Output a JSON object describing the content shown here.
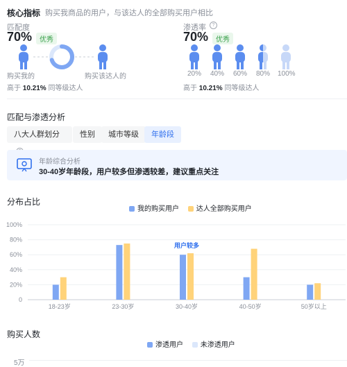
{
  "header": {
    "title": "核心指标",
    "subtitle": "购买我商品的用户，与该达人的全部购买用户相比"
  },
  "match": {
    "label": "匹配度",
    "value": "70%",
    "badge": "优秀",
    "left_caption": "购买我的",
    "right_caption": "购买该达人的",
    "compare_prefix": "高于",
    "compare_value": "10.21%",
    "compare_suffix": "同等级达人",
    "ring_fraction": 0.7
  },
  "penetration": {
    "label": "渗透率",
    "value": "70%",
    "badge": "优秀",
    "levels": [
      "20%",
      "40%",
      "60%",
      "80%",
      "100%"
    ],
    "compare_prefix": "高于",
    "compare_value": "10.21%",
    "compare_suffix": "同等级达人",
    "fill_fraction": 0.7
  },
  "analysis": {
    "title": "匹配与渗透分析",
    "tabs": [
      "八大人群划分",
      "性别",
      "城市等级",
      "年龄段"
    ],
    "active_tab": "年龄段",
    "callout_title": "年龄综合分析",
    "callout_text": "30-40岁年龄段，用户较多但渗透较差，建议重点关注"
  },
  "distribution": {
    "title": "分布占比",
    "legend": [
      "我的购买用户",
      "达人全部购买用户"
    ],
    "annotation": "用户较多"
  },
  "buyers": {
    "title": "购买人数",
    "legend": [
      "渗透用户",
      "未渗透用户"
    ],
    "y_first_tick": "5万"
  },
  "colors": {
    "blue": "#7fa7f3",
    "yellow": "#ffd37a",
    "light_blue": "#dbe7fb",
    "figure_blue": "#5b8def",
    "accent": "#2f6fed",
    "good": "#3aa14b"
  },
  "chart_data": {
    "type": "bar",
    "categories": [
      "18-23岁",
      "23-30岁",
      "30-40岁",
      "40-50岁",
      "50岁以上"
    ],
    "series": [
      {
        "name": "我的购买用户",
        "values": [
          20,
          73,
          60,
          30,
          20
        ]
      },
      {
        "name": "达人全部购买用户",
        "values": [
          30,
          75,
          62,
          68,
          22
        ]
      }
    ],
    "yticks": [
      "0",
      "20%",
      "40%",
      "60%",
      "80%",
      "100%"
    ],
    "ylim": [
      0,
      100
    ],
    "annotation": {
      "category": "30-40岁",
      "text": "用户较多"
    },
    "legend_position": "top-center"
  }
}
